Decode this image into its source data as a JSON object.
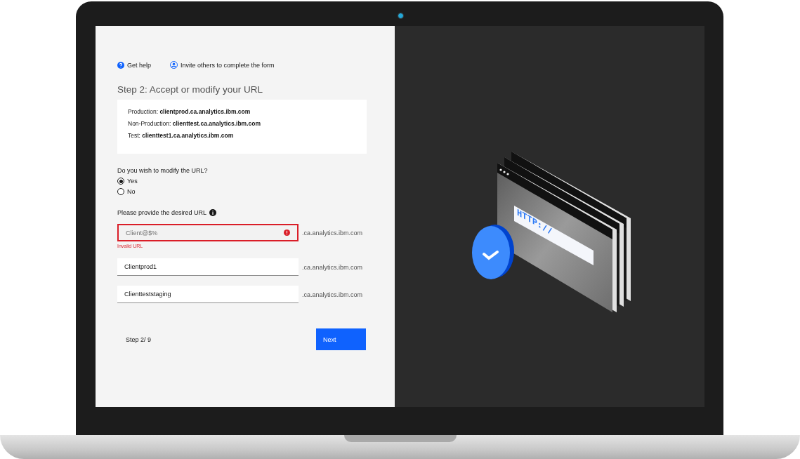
{
  "links": [
    {
      "kind": "help",
      "label": "Get help"
    },
    {
      "kind": "invite",
      "label": "Invite others to complete the form"
    }
  ],
  "title": "Step 2: Accept or modify your URL",
  "urls": [
    {
      "label": "Production:",
      "value": "clientprod.ca.analytics.ibm.com"
    },
    {
      "label": "Non-Production:",
      "value": "clienttest.ca.analytics.ibm.com"
    },
    {
      "label": "Test:",
      "value": "clienttest1.ca.analytics.ibm.com"
    }
  ],
  "question": "Do you wish to modify the URL?",
  "options": [
    {
      "label": "Yes",
      "selected": true
    },
    {
      "label": "No",
      "selected": false
    }
  ],
  "url_prompt": "Please provide the desired URL",
  "url_fields": [
    {
      "value": "Client@$%",
      "invalid": true,
      "error": "Invalid URL",
      "suffix": ".ca.analytics.ibm.com"
    },
    {
      "value": "Clientprod1",
      "invalid": false,
      "suffix": ".ca.analytics.ibm.com"
    },
    {
      "value": "Clientteststaging",
      "invalid": false,
      "suffix": ".ca.analytics.ibm.com"
    }
  ],
  "step": "Step 2/ 9",
  "next": "Next",
  "illustration": {
    "url_text": "HTTP://"
  }
}
